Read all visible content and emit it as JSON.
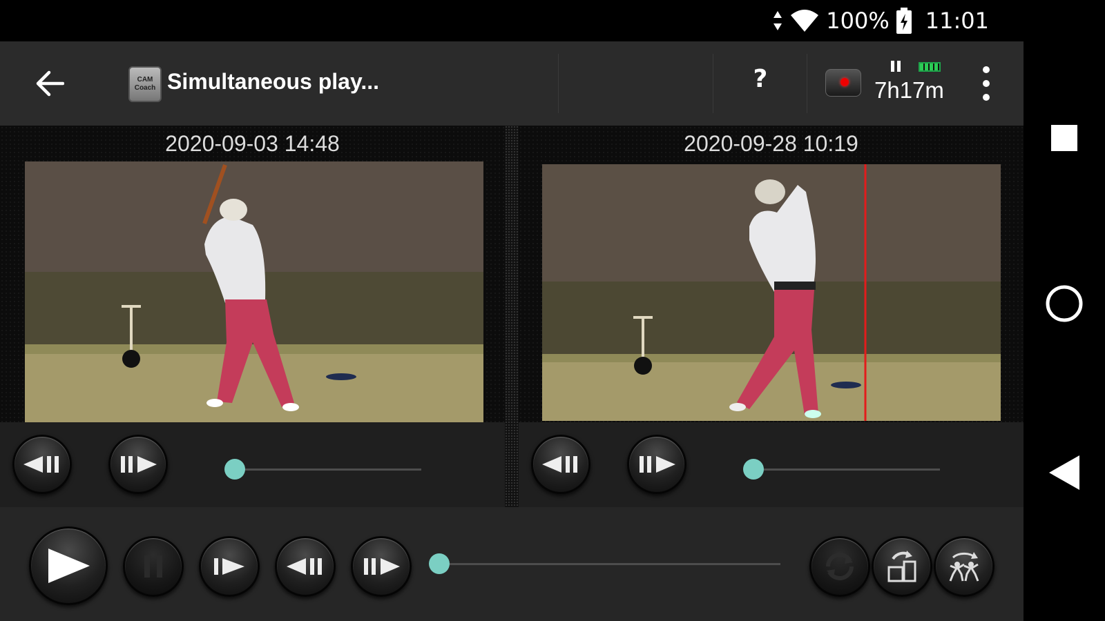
{
  "status_bar": {
    "battery": "100%",
    "time": "11:01"
  },
  "app_bar": {
    "logo_text_1": "CAM",
    "logo_text_2": "Coach",
    "title": "Simultaneous play...",
    "help": "?",
    "remaining_time": "7h17m"
  },
  "left_video": {
    "timestamp": "2020-09-03 14:48",
    "position": 0.0
  },
  "right_video": {
    "timestamp": "2020-09-28 10:19",
    "position": 0.0
  },
  "main_seek": {
    "position": 0.0
  },
  "icons": {
    "back": "arrow-left-icon",
    "record": "record-icon",
    "more": "more-vert-icon",
    "stop": "square-icon",
    "home": "circle-icon",
    "nav_back": "triangle-left-icon"
  }
}
